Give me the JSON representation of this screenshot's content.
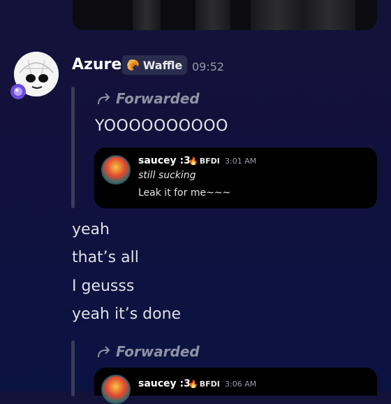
{
  "message": {
    "author": "Azure",
    "tag": {
      "icon": "🥐",
      "label": "Waffle"
    },
    "time": "09:52",
    "forward_label": "Forwarded",
    "forwarded_text": "YOOOOOOOOOO",
    "embed1": {
      "author": "saucey :3",
      "tag": {
        "icon": "🔥",
        "label": "BFDI"
      },
      "time": "3:01 AM",
      "line1": "still sucking",
      "line2": "Leak it for me~~~"
    },
    "lines": [
      "yeah",
      "that’s all",
      "I geusss",
      "yeah it’s done"
    ],
    "forward2_label": "Forwarded",
    "embed2": {
      "author": "saucey :3",
      "tag": {
        "icon": "🔥",
        "label": "BFDI"
      },
      "time": "3:06 AM"
    }
  },
  "icons": {
    "forward": "forward-arrow-icon",
    "avatar": "skull-avatar",
    "badge": "purple-gem-badge"
  }
}
